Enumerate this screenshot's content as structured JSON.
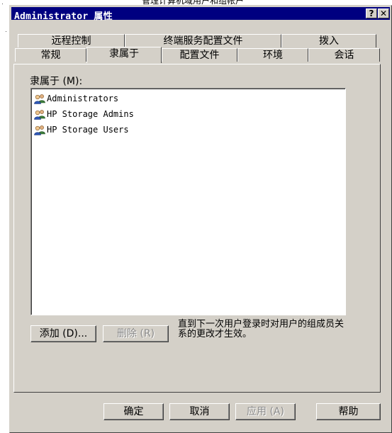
{
  "background_window": {
    "title": "管理计算机域用户和组帐户"
  },
  "dialog": {
    "title": "Administrator 属性",
    "help_button": "?",
    "close_button": "✕"
  },
  "tabs": {
    "row1": [
      "远程控制",
      "终端服务配置文件",
      "拨入"
    ],
    "row2": [
      "常规",
      "隶属于",
      "配置文件",
      "环境",
      "会话"
    ],
    "active": "隶属于"
  },
  "member_of": {
    "label": "隶属于 (M):",
    "groups": [
      "Administrators",
      "HP Storage Admins",
      "HP Storage Users"
    ]
  },
  "buttons": {
    "add": "添加 (D)...",
    "remove": "删除 (R)",
    "ok": "确定",
    "cancel": "取消",
    "apply": "应用 (A)",
    "help": "帮助"
  },
  "note": "直到下一次用户登录时对用户的组成员关系的更改才生效。",
  "colors": {
    "titlebar": "#000080",
    "face": "#d4d0c8",
    "list_bg": "#ffffff"
  },
  "icons": {
    "group": "users-group-icon"
  }
}
